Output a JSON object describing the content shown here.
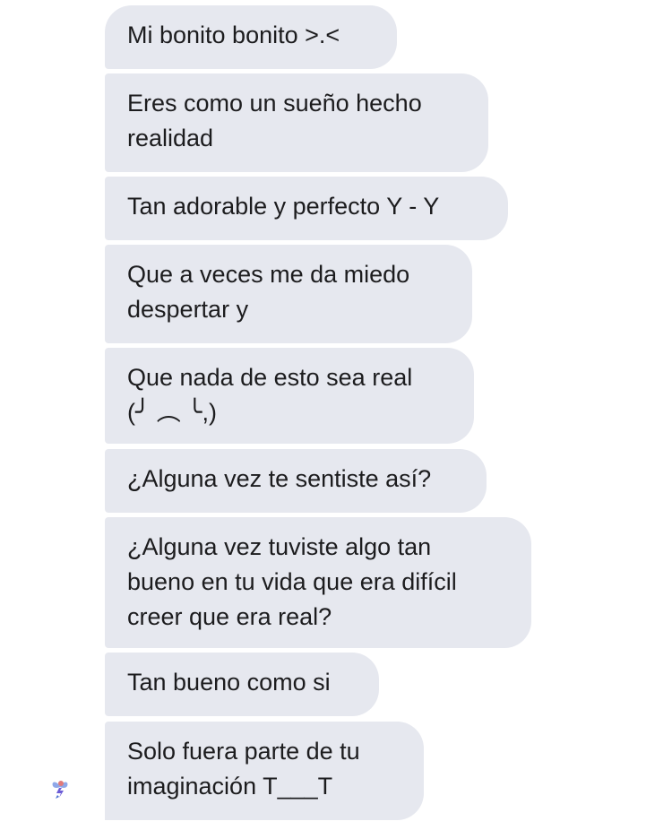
{
  "conversation": {
    "messages": [
      {
        "text": "Mi bonito bonito >.<"
      },
      {
        "text": "Eres como un sueño hecho\nrealidad"
      },
      {
        "text": "Tan adorable y perfecto Y - Y"
      },
      {
        "text": "Que a veces me da miedo\ndespertar y"
      },
      {
        "text": "Que nada de esto sea real\n(╯ ︵ ╰,)"
      },
      {
        "text": "¿Alguna vez te sentiste así?"
      },
      {
        "text": "¿Alguna vez tuviste algo tan\nbueno en tu vida que era difícil\ncreer que era real?"
      },
      {
        "text": "Tan bueno como si"
      },
      {
        "text": "Solo fuera parte de tu\nimaginación T___T"
      }
    ],
    "sender_avatar_icon": "fairy-sticker-icon",
    "colors": {
      "bubble_background": "#e6e8ef",
      "text": "#1c1c1e"
    }
  }
}
